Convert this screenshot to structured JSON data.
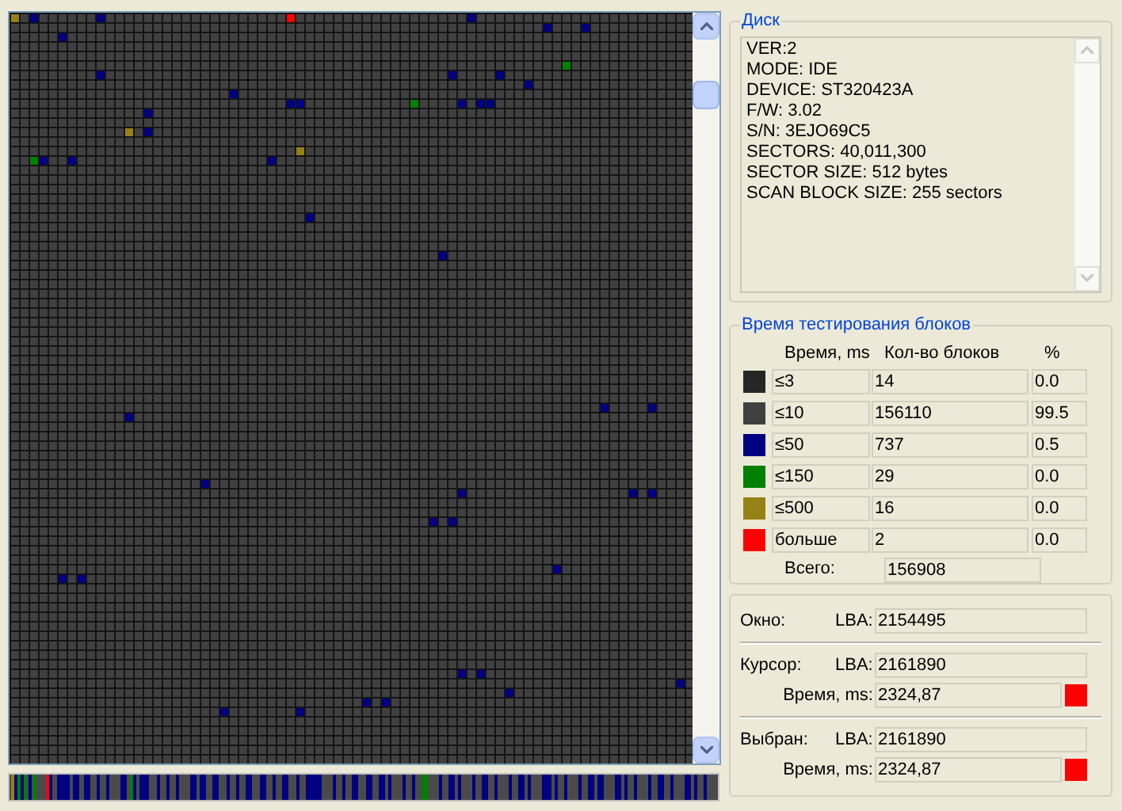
{
  "disk": {
    "title": "Диск",
    "lines": [
      "VER:2",
      "MODE: IDE",
      "DEVICE: ST320423A",
      "F/W: 3.02",
      "S/N: 3EJO69C5",
      "SECTORS: 40,011,300",
      "SECTOR SIZE: 512 bytes",
      "SCAN BLOCK SIZE: 255 sectors"
    ]
  },
  "timing": {
    "title": "Время тестирования блоков",
    "columns": [
      "Время, ms",
      "Кол-во блоков",
      "%"
    ],
    "rows": [
      {
        "color": "#262626",
        "time": "≤3",
        "count": "14",
        "percent": "0.0"
      },
      {
        "color": "#404040",
        "time": "≤10",
        "count": "156110",
        "percent": "99.5"
      },
      {
        "color": "#000080",
        "time": "≤50",
        "count": "737",
        "percent": "0.5"
      },
      {
        "color": "#008000",
        "time": "≤150",
        "count": "29",
        "percent": "0.0"
      },
      {
        "color": "#968214",
        "time": "≤500",
        "count": "16",
        "percent": "0.0"
      },
      {
        "color": "#ff0000",
        "time": "больше",
        "count": "2",
        "percent": "0.0"
      }
    ],
    "total_label": "Всего:",
    "total": "156908"
  },
  "position": [
    {
      "label": "Окно:",
      "lba_label": "LBA:",
      "lba": "2154495"
    },
    {
      "label": "Курсор:",
      "lba_label": "LBA:",
      "lba": "2161890",
      "time_label": "Время, ms:",
      "time": "2324,87",
      "color": "#ff0000"
    },
    {
      "label": "Выбран:",
      "lba_label": "LBA:",
      "lba": "2161890",
      "time_label": "Время, ms:",
      "time": "2324,87",
      "color": "#ff0000"
    }
  ]
}
